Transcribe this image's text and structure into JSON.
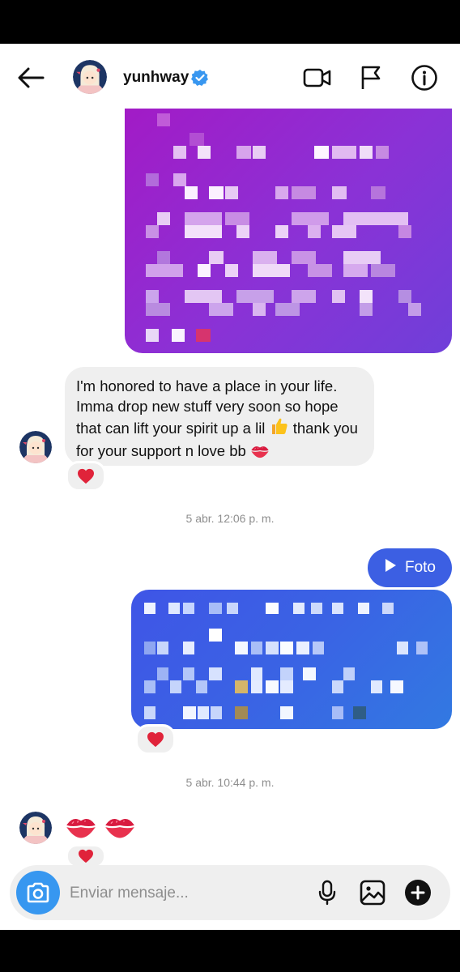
{
  "header": {
    "username": "yunhway",
    "verified": true,
    "icons": [
      "back-arrow-icon",
      "video-call-icon",
      "flag-icon",
      "info-icon"
    ]
  },
  "messages": {
    "incoming_text": "I'm honored to have a place in your life. Imma drop new stuff very soon so hope that can lift your spirit up a lil",
    "incoming_text_tail": "thank you for your support n love bb",
    "incoming_emojis": [
      "thumbs-up-icon",
      "kiss-mark-icon"
    ],
    "reaction": "red-heart",
    "timestamp_1": "5 abr. 12:06 p. m.",
    "outgoing_label": "Foto",
    "timestamp_2": "5 abr. 10:44 p. m.",
    "last_incoming": [
      "kiss-mark-icon",
      "kiss-mark-icon"
    ]
  },
  "composer": {
    "placeholder": "Enviar mensaje..."
  },
  "colors": {
    "accent_blue": "#3797f0",
    "verified_blue": "#3897f0",
    "outgoing_bubble": "#3c5fe3",
    "incoming_bubble": "#efefef",
    "purple_media": "#8a32d6",
    "heart_red": "#e0233a"
  }
}
